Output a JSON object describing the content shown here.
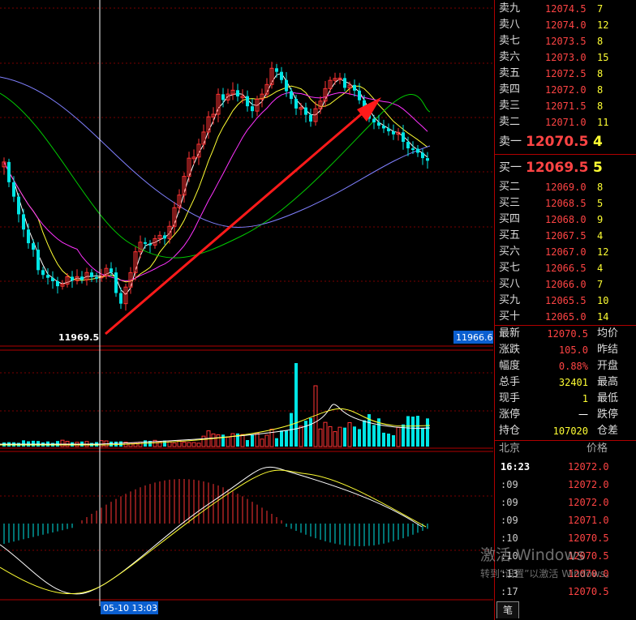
{
  "chart": {
    "low_label": "11969.5",
    "right_price_label": "11966.6",
    "time_label": "05-10 13:03",
    "colors": {
      "up": "#ff3333",
      "down": "#00e5e5",
      "ma5": "#ffffff",
      "ma10": "#ffff33",
      "ma20": "#ff33ff",
      "ma40": "#00cc00",
      "ma60": "#8080ff",
      "arrow": "#ff0000"
    }
  },
  "order_book": {
    "asks": [
      {
        "label": "卖九",
        "price": "12074.5",
        "vol": "7"
      },
      {
        "label": "卖八",
        "price": "12074.0",
        "vol": "12"
      },
      {
        "label": "卖七",
        "price": "12073.5",
        "vol": "8"
      },
      {
        "label": "卖六",
        "price": "12073.0",
        "vol": "15"
      },
      {
        "label": "卖五",
        "price": "12072.5",
        "vol": "8"
      },
      {
        "label": "卖四",
        "price": "12072.0",
        "vol": "8"
      },
      {
        "label": "卖三",
        "price": "12071.5",
        "vol": "8"
      },
      {
        "label": "卖二",
        "price": "12071.0",
        "vol": "11"
      },
      {
        "label": "卖一",
        "price": "12070.5",
        "vol": "4"
      }
    ],
    "bids": [
      {
        "label": "买一",
        "price": "12069.5",
        "vol": "5"
      },
      {
        "label": "买二",
        "price": "12069.0",
        "vol": "8"
      },
      {
        "label": "买三",
        "price": "12068.5",
        "vol": "5"
      },
      {
        "label": "买四",
        "price": "12068.0",
        "vol": "9"
      },
      {
        "label": "买五",
        "price": "12067.5",
        "vol": "4"
      },
      {
        "label": "买六",
        "price": "12067.0",
        "vol": "12"
      },
      {
        "label": "买七",
        "price": "12066.5",
        "vol": "4"
      },
      {
        "label": "买八",
        "price": "12066.0",
        "vol": "7"
      },
      {
        "label": "买九",
        "price": "12065.5",
        "vol": "10"
      },
      {
        "label": "买十",
        "price": "12065.0",
        "vol": "14"
      }
    ]
  },
  "stats": [
    {
      "k": "最新",
      "v": "12070.5",
      "k2": "均价",
      "color": "red"
    },
    {
      "k": "涨跌",
      "v": "105.0",
      "k2": "昨结",
      "color": "red"
    },
    {
      "k": "幅度",
      "v": "0.88%",
      "k2": "开盘",
      "color": "red"
    },
    {
      "k": "总手",
      "v": "32401",
      "k2": "最高",
      "color": "yel"
    },
    {
      "k": "现手",
      "v": "1",
      "k2": "最低",
      "color": "yel"
    },
    {
      "k": "涨停",
      "v": "一",
      "k2": "跌停",
      "color": "wht"
    },
    {
      "k": "持仓",
      "v": "107020",
      "k2": "仓差",
      "color": "yel"
    }
  ],
  "ticks": {
    "head_left": "北京",
    "head_right": "价格",
    "rows": [
      {
        "t": "16:23",
        "p": "12072.0"
      },
      {
        "t": ":09",
        "p": "12072.0"
      },
      {
        "t": ":09",
        "p": "12072.0"
      },
      {
        "t": ":09",
        "p": "12071.0"
      },
      {
        "t": ":10",
        "p": "12070.5"
      },
      {
        "t": ":10",
        "p": "12070.5"
      },
      {
        "t": ":13",
        "p": "12070.0"
      },
      {
        "t": ":17",
        "p": "12070.5"
      }
    ]
  },
  "tab_label": "笔",
  "watermark": {
    "line1": "激活 Windows",
    "line2": "转到“设置”以激活 Windows。"
  }
}
